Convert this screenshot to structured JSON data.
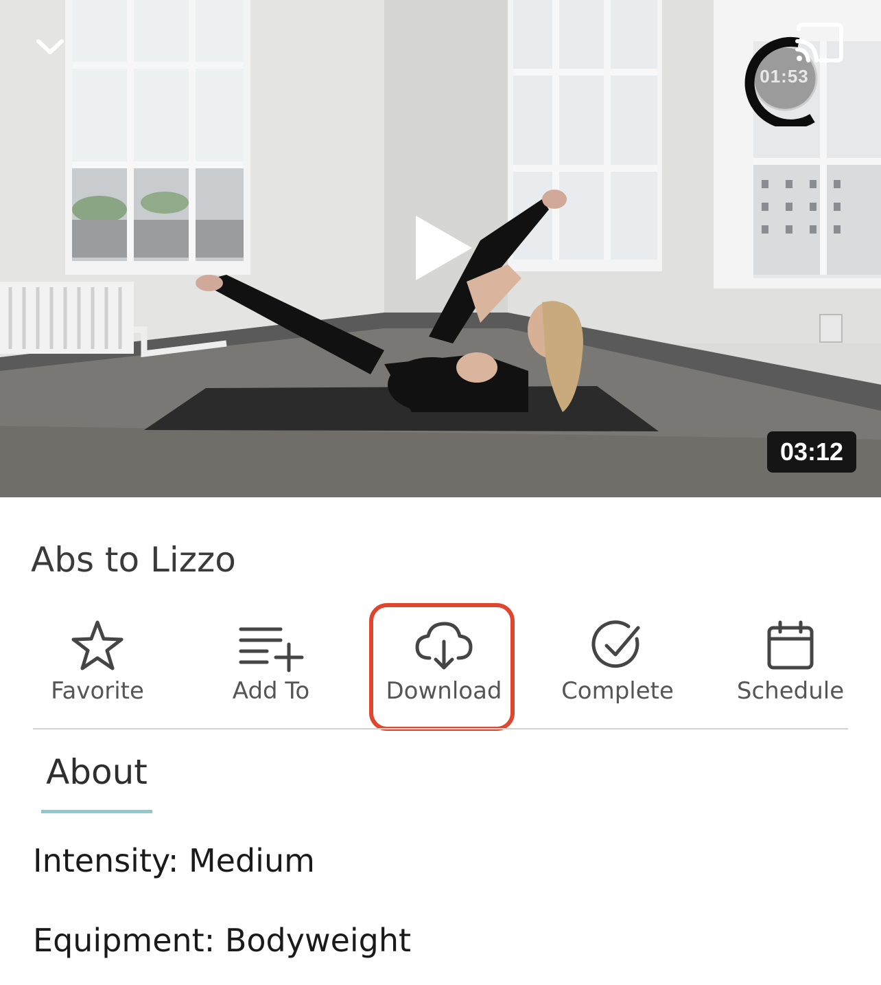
{
  "player": {
    "timer": "01:53",
    "duration": "03:12",
    "icons": {
      "collapse": "chevron-down-icon",
      "cast": "cast-icon",
      "play": "play-icon"
    }
  },
  "workout": {
    "title": "Abs to Lizzo"
  },
  "actions": [
    {
      "label": "Favorite",
      "icon": "star-icon"
    },
    {
      "label": "Add To",
      "icon": "playlist-add-icon"
    },
    {
      "label": "Download",
      "icon": "cloud-download-icon"
    },
    {
      "label": "Complete",
      "icon": "check-circle-icon"
    },
    {
      "label": "Schedule",
      "icon": "calendar-icon"
    }
  ],
  "tabs": {
    "about": "About"
  },
  "details": {
    "intensity": "Intensity: Medium",
    "equipment": "Equipment: Bodyweight"
  },
  "colors": {
    "highlight": "#e0452e",
    "tab_underline": "#8ccacb",
    "duration_badge": "#151515"
  }
}
